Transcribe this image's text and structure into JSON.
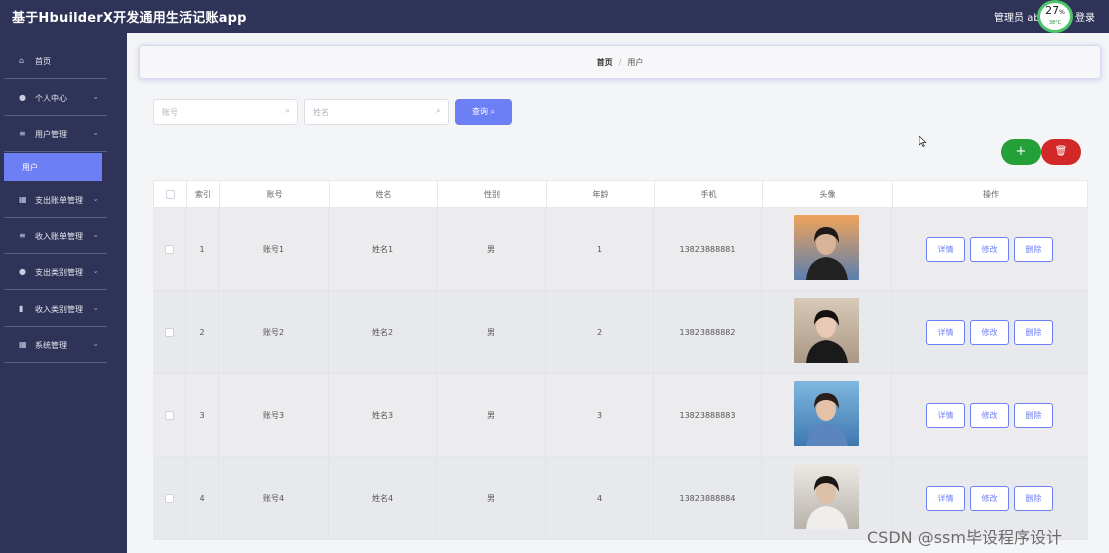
{
  "app": {
    "title": "基于HbuilderX开发通用生活记账app",
    "user_label": "管理员 abo",
    "logout_label": "登录"
  },
  "cpu_badge": {
    "percent": "27",
    "unit": "%",
    "temp": "38°C"
  },
  "sidebar": {
    "items": [
      {
        "label": "首页",
        "icon": "home-icon",
        "glyph": "⌂"
      },
      {
        "label": "个人中心",
        "icon": "user-icon",
        "glyph": "●"
      },
      {
        "label": "用户管理",
        "icon": "list-icon",
        "glyph": "≡"
      },
      {
        "label": "支出账单管理",
        "icon": "grid-icon",
        "glyph": "▦"
      },
      {
        "label": "收入账单管理",
        "icon": "list-icon",
        "glyph": "≡"
      },
      {
        "label": "支出类别管理",
        "icon": "user-icon",
        "glyph": "●"
      },
      {
        "label": "收入类别管理",
        "icon": "bar-chart-icon",
        "glyph": "▮"
      },
      {
        "label": "系统管理",
        "icon": "grid-icon",
        "glyph": "▦"
      }
    ],
    "active_sub": "用户"
  },
  "breadcrumb": {
    "home": "首页",
    "separator": "/",
    "current": "用户"
  },
  "search": {
    "account_placeholder": "账号",
    "name_placeholder": "姓名",
    "query_label": "查询",
    "search_glyph": "⌕"
  },
  "actions": {
    "add_glyph": "+",
    "delete_glyph": "🗑"
  },
  "table": {
    "headers": [
      "索引",
      "账号",
      "姓名",
      "性别",
      "年龄",
      "手机",
      "头像",
      "操作"
    ],
    "rows": [
      {
        "index": "1",
        "account": "账号1",
        "name": "姓名1",
        "gender": "男",
        "age": "1",
        "phone": "13823888881"
      },
      {
        "index": "2",
        "account": "账号2",
        "name": "姓名2",
        "gender": "男",
        "age": "2",
        "phone": "13823888882"
      },
      {
        "index": "3",
        "account": "账号3",
        "name": "姓名3",
        "gender": "男",
        "age": "3",
        "phone": "13823888883"
      },
      {
        "index": "4",
        "account": "账号4",
        "name": "姓名4",
        "gender": "男",
        "age": "4",
        "phone": "13823888884"
      }
    ],
    "op_labels": {
      "detail": "详情",
      "edit": "修改",
      "delete": "删除"
    }
  },
  "watermark": "CSDN @ssm毕设程序设计",
  "colors": {
    "topbar": "#2f3357",
    "accent": "#6d7ff5",
    "add": "#23a037",
    "delete": "#d32828"
  }
}
